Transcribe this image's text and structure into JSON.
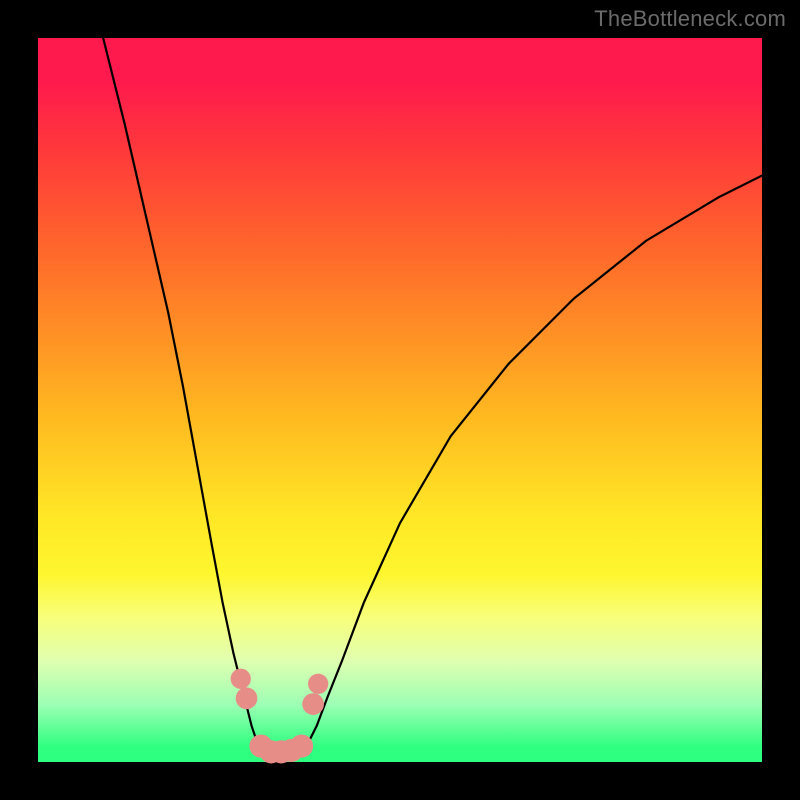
{
  "watermark": "TheBottleneck.com",
  "chart_data": {
    "type": "line",
    "title": "",
    "xlabel": "",
    "ylabel": "",
    "xlim": [
      0,
      100
    ],
    "ylim": [
      0,
      100
    ],
    "series": [
      {
        "name": "left-curve",
        "x": [
          9,
          12,
          15,
          18,
          20,
          22,
          24,
          25.5,
          27,
          28.5,
          29.5,
          30.5
        ],
        "y": [
          100,
          88,
          75,
          62,
          52,
          41,
          30,
          22,
          15,
          9,
          5,
          2
        ]
      },
      {
        "name": "right-curve",
        "x": [
          37,
          38.5,
          40,
          42,
          45,
          50,
          57,
          65,
          74,
          84,
          94,
          100
        ],
        "y": [
          2,
          5,
          9,
          14,
          22,
          33,
          45,
          55,
          64,
          72,
          78,
          81
        ]
      },
      {
        "name": "valley-floor",
        "x": [
          30.5,
          32,
          34,
          36,
          37
        ],
        "y": [
          2,
          1,
          1,
          1,
          2
        ]
      }
    ],
    "markers": {
      "name": "salmon-dots",
      "color": "#e78d88",
      "points": [
        {
          "x": 28.0,
          "y": 11.5,
          "r": 1.4
        },
        {
          "x": 28.8,
          "y": 8.8,
          "r": 1.5
        },
        {
          "x": 30.8,
          "y": 2.2,
          "r": 1.6
        },
        {
          "x": 32.2,
          "y": 1.4,
          "r": 1.6
        },
        {
          "x": 33.6,
          "y": 1.4,
          "r": 1.6
        },
        {
          "x": 35.0,
          "y": 1.6,
          "r": 1.6
        },
        {
          "x": 36.4,
          "y": 2.2,
          "r": 1.6
        },
        {
          "x": 38.0,
          "y": 8.0,
          "r": 1.5
        },
        {
          "x": 38.7,
          "y": 10.8,
          "r": 1.4
        }
      ]
    }
  }
}
